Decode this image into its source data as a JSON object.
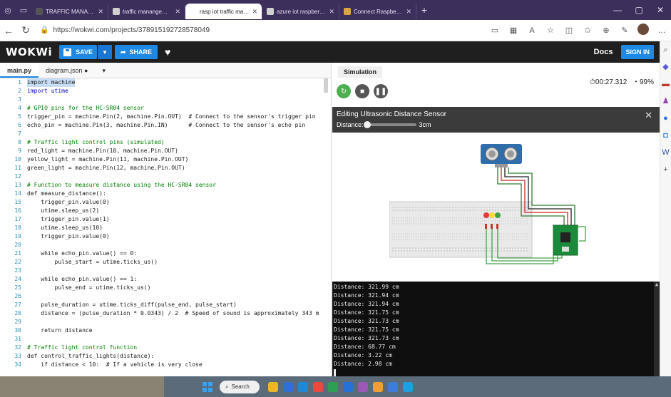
{
  "browser": {
    "tabs": [
      {
        "label": "TRAFFIC MANAGEMENT - Wokwi",
        "active": false,
        "favicon_color": "#555555"
      },
      {
        "label": "traffic manangement using arduino",
        "active": false,
        "favicon_color": "#d0d0d0"
      },
      {
        "label": "rasp iot traffic management - Wi",
        "active": true,
        "favicon_color": "#ffffff"
      },
      {
        "label": "azure iot raspberry pi - Search",
        "active": false,
        "favicon_color": "#d0d0d0"
      },
      {
        "label": "Connect Raspberry Pi to Azure I",
        "active": false,
        "favicon_color": "#d9a441"
      }
    ],
    "new_tab": "+",
    "url": "https://wokwi.com/projects/378915192728578049"
  },
  "wokwi": {
    "logo": "WOKWi",
    "save_label": "SAVE",
    "share_label": "SHARE",
    "docs_label": "Docs",
    "signin_label": "SIGN IN"
  },
  "editor": {
    "tabs": [
      {
        "label": "main.py",
        "active": true
      },
      {
        "label": "diagram.json ●",
        "active": false
      }
    ],
    "tab_menu": "▾",
    "lines": [
      {
        "n": "1",
        "t": "import machine",
        "c": "sel"
      },
      {
        "n": "2",
        "t": "import utime",
        "c": "kw"
      },
      {
        "n": "3",
        "t": "",
        "c": ""
      },
      {
        "n": "4",
        "t": "# GPIO pins for the HC-SR04 sensor",
        "c": "cm"
      },
      {
        "n": "5",
        "t": "trigger_pin = machine.Pin(2, machine.Pin.OUT)  # Connect to the sensor's trigger pin",
        "c": ""
      },
      {
        "n": "6",
        "t": "echo_pin = machine.Pin(3, machine.Pin.IN)      # Connect to the sensor's echo pin",
        "c": ""
      },
      {
        "n": "7",
        "t": "",
        "c": ""
      },
      {
        "n": "8",
        "t": "# Traffic light control pins (simulated)",
        "c": "cm"
      },
      {
        "n": "9",
        "t": "red_light = machine.Pin(10, machine.Pin.OUT)",
        "c": ""
      },
      {
        "n": "10",
        "t": "yellow_light = machine.Pin(11, machine.Pin.OUT)",
        "c": ""
      },
      {
        "n": "11",
        "t": "green_light = machine.Pin(12, machine.Pin.OUT)",
        "c": ""
      },
      {
        "n": "12",
        "t": "",
        "c": ""
      },
      {
        "n": "13",
        "t": "# Function to measure distance using the HC-SR04 sensor",
        "c": "cm"
      },
      {
        "n": "14",
        "t": "def measure_distance():",
        "c": ""
      },
      {
        "n": "15",
        "t": "    trigger_pin.value(0)",
        "c": ""
      },
      {
        "n": "16",
        "t": "    utime.sleep_us(2)",
        "c": ""
      },
      {
        "n": "17",
        "t": "    trigger_pin.value(1)",
        "c": ""
      },
      {
        "n": "18",
        "t": "    utime.sleep_us(10)",
        "c": ""
      },
      {
        "n": "19",
        "t": "    trigger_pin.value(0)",
        "c": ""
      },
      {
        "n": "20",
        "t": "",
        "c": ""
      },
      {
        "n": "21",
        "t": "    while echo_pin.value() == 0:",
        "c": ""
      },
      {
        "n": "22",
        "t": "        pulse_start = utime.ticks_us()",
        "c": ""
      },
      {
        "n": "23",
        "t": "",
        "c": ""
      },
      {
        "n": "24",
        "t": "    while echo_pin.value() == 1:",
        "c": ""
      },
      {
        "n": "25",
        "t": "        pulse_end = utime.ticks_us()",
        "c": ""
      },
      {
        "n": "26",
        "t": "",
        "c": ""
      },
      {
        "n": "27",
        "t": "    pulse_duration = utime.ticks_diff(pulse_end, pulse_start)",
        "c": ""
      },
      {
        "n": "28",
        "t": "    distance = (pulse_duration * 0.0343) / 2  # Speed of sound is approximately 343 m",
        "c": ""
      },
      {
        "n": "29",
        "t": "",
        "c": ""
      },
      {
        "n": "30",
        "t": "    return distance",
        "c": ""
      },
      {
        "n": "31",
        "t": "",
        "c": ""
      },
      {
        "n": "32",
        "t": "# Traffic light control function",
        "c": "cm"
      },
      {
        "n": "33",
        "t": "def control_traffic_lights(distance):",
        "c": ""
      },
      {
        "n": "34",
        "t": "    if distance < 10:  # If a vehicle is very close",
        "c": ""
      }
    ]
  },
  "simulation": {
    "tab_label": "Simulation",
    "timer": "⏱00:27.312",
    "speed": "99%",
    "panel_title": "Editing Ultrasonic Distance Sensor",
    "distance_label": "Distance:",
    "distance_value": "3cm",
    "distance_fraction": 0.02,
    "accent_color": "#4caf50"
  },
  "serial": {
    "lines": [
      "Distance: 321.99 cm",
      "Distance: 321.94 cm",
      "Distance: 321.94 cm",
      "Distance: 321.75 cm",
      "Distance: 321.73 cm",
      "Distance: 321.75 cm",
      "Distance: 321.73 cm",
      "Distance: 68.77 cm",
      "Distance: 3.22 cm",
      "Distance: 2.98 cm"
    ]
  },
  "taskbar": {
    "search_label": "Search",
    "app_colors": [
      "#e8b923",
      "#2f6fd6",
      "#1c8adb",
      "#e84b3c",
      "#2f9e55",
      "#2670d9",
      "#9b59b6",
      "#f0a030",
      "#3b7dd8",
      "#1aa1e0"
    ]
  }
}
